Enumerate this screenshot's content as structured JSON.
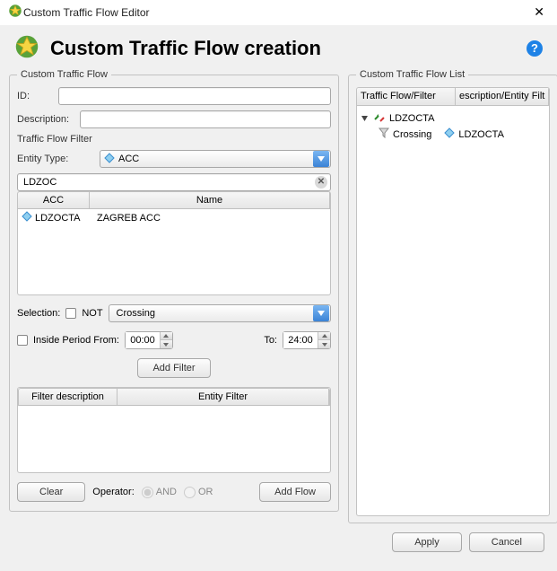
{
  "window": {
    "title": "Custom Traffic Flow Editor",
    "header": "Custom Traffic Flow creation"
  },
  "left": {
    "group_title": "Custom Traffic Flow",
    "id_label": "ID:",
    "id_value": "",
    "desc_label": "Description:",
    "desc_value": "",
    "filter_section": "Traffic Flow Filter",
    "entity_type_label": "Entity Type:",
    "entity_type_value": "ACC",
    "search_value": "LDZOC",
    "grid": {
      "columns": {
        "acc": "ACC",
        "name": "Name"
      },
      "rows": [
        {
          "acc": "LDZOCTA",
          "name": "ZAGREB ACC"
        }
      ]
    },
    "selection_label": "Selection:",
    "not_label": "NOT",
    "selection_value": "Crossing",
    "period_label": "Inside Period From:",
    "from_value": "00:00",
    "to_label": "To:",
    "to_value": "24:00",
    "add_filter_label": "Add Filter",
    "filter_grid": {
      "columns": {
        "fd": "Filter description",
        "ef": "Entity Filter"
      }
    },
    "clear_label": "Clear",
    "operator_label": "Operator:",
    "and_label": "AND",
    "or_label": "OR",
    "add_flow_label": "Add Flow"
  },
  "right": {
    "group_title": "Custom Traffic Flow List",
    "columns": {
      "left": "Traffic Flow/Filter",
      "right": "escription/Entity Filt"
    },
    "tree": {
      "root": "LDZOCTA",
      "child_left": "Crossing",
      "child_right": "LDZOCTA"
    }
  },
  "footer": {
    "apply": "Apply",
    "cancel": "Cancel"
  }
}
